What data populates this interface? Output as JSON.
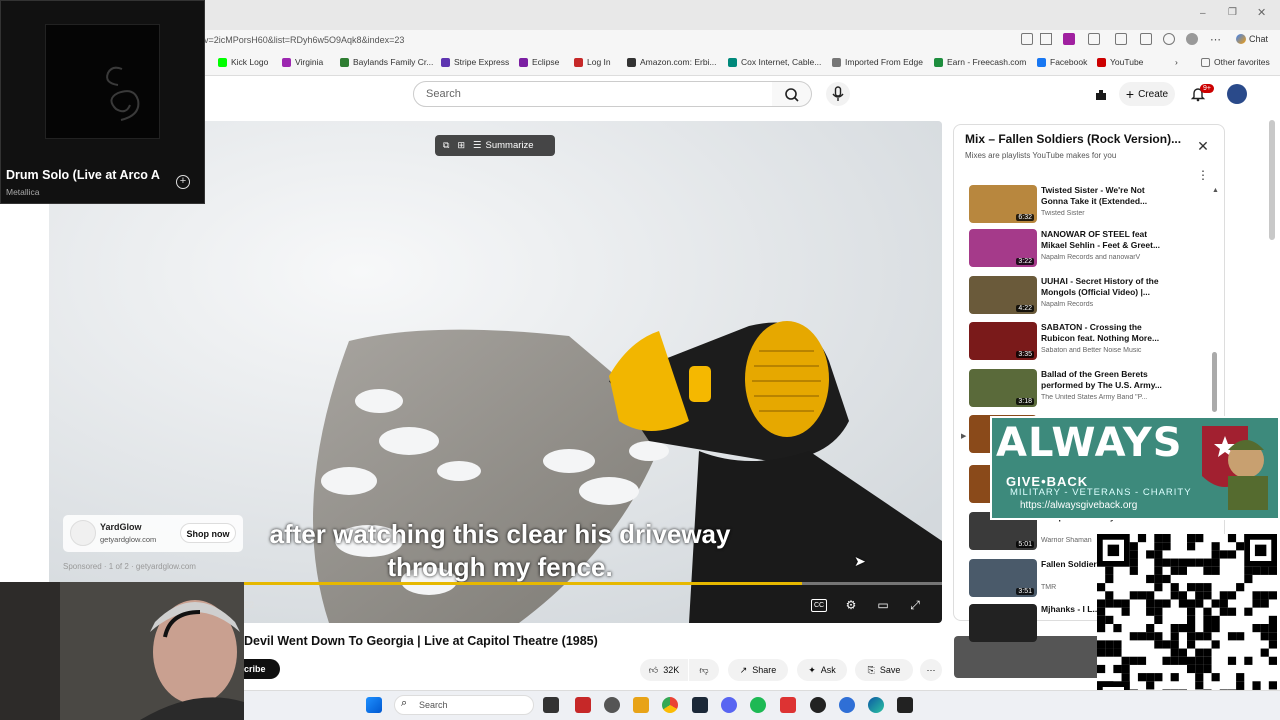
{
  "browser": {
    "url": "v=2icMPorsH60&list=RDyh6w5O9Aqk8&index=23",
    "bookmarks": [
      "Kick Logo",
      "Virginia",
      "Baylands Family Cr...",
      "Stripe Express",
      "Eclipse",
      "Log In",
      "Amazon.com: Erbi...",
      "Cox Internet, Cable...",
      "Imported From Edge",
      "Earn - Freecash.com",
      "Facebook",
      "YouTube"
    ],
    "other_favorites": "Other favorites",
    "chat_label": "Chat"
  },
  "youtube": {
    "search_placeholder": "Search",
    "create_label": "Create",
    "notif_count": "9+"
  },
  "mini_player": {
    "title": "Drum Solo (Live at Arco A",
    "artist": "Metallica"
  },
  "video": {
    "summarize_label": "Summarize",
    "caption_line1": "after watching this clear his driveway",
    "caption_line2": "through my fence.",
    "progress_fraction": 0.8,
    "time_fragment": "52",
    "title": "Devil Went Down To Georgia | Live at Capitol Theatre (1985)",
    "subscribe_label": "Subscribe",
    "likes": "32K",
    "share_label": "Share",
    "ask_label": "Ask",
    "save_label": "Save"
  },
  "ad": {
    "name": "YardGlow",
    "url": "getyardglow.com",
    "button": "Shop now",
    "sponsored": "Sponsored · 1 of 2 · getyardglow.com"
  },
  "playlist": {
    "title": "Mix – Fallen Soldiers (Rock Version)...",
    "subtitle": "Mixes are playlists YouTube makes for you",
    "items": [
      {
        "title": "Twisted Sister - We're Not Gonna Take it (Extended...",
        "channel": "Twisted Sister",
        "duration": "6:32",
        "color": "#b8873e"
      },
      {
        "title": "NANOWAR OF STEEL feat Mikael Sehlin - Feet & Greet...",
        "channel": "Napalm Records and nanowarV",
        "duration": "3:22",
        "color": "#a53a8a"
      },
      {
        "title": "UUHAI - Secret History of the Mongols (Official Video) |...",
        "channel": "Napalm Records",
        "duration": "4:22",
        "color": "#6a5a3a"
      },
      {
        "title": "SABATON - Crossing the Rubicon feat. Nothing More...",
        "channel": "Sabaton and Better Noise Music",
        "duration": "3:35",
        "color": "#7a1a1a"
      },
      {
        "title": "Ballad of the Green Berets performed by The U.S. Army...",
        "channel": "The United States Army Band \"P...",
        "duration": "3:18",
        "color": "#5a6a3a"
      },
      {
        "title": "Jumped a Monkey Remix",
        "channel": "Warrior Shaman",
        "duration": "5:01",
        "color": "#3a3a3a"
      },
      {
        "title": "Fallen Soldiers @TheMarine...",
        "channel": "TMR",
        "duration": "3:51",
        "color": "#4a5a6a"
      },
      {
        "title": "Mjhanks - I L... Topher and T...",
        "channel": "",
        "duration": "",
        "color": "#222222"
      }
    ]
  },
  "overlay": {
    "line1": "ALWAYS",
    "line2": "GIVE•BACK",
    "tagline": "MILITARY - VETERANS - CHARITY",
    "url": "https://alwaysgiveback.org"
  },
  "taskbar": {
    "search_placeholder": "Search"
  },
  "colors": {
    "accent": "#cc0000",
    "progress": "#e6b800",
    "overlay_bg": "#3d8a7c"
  }
}
